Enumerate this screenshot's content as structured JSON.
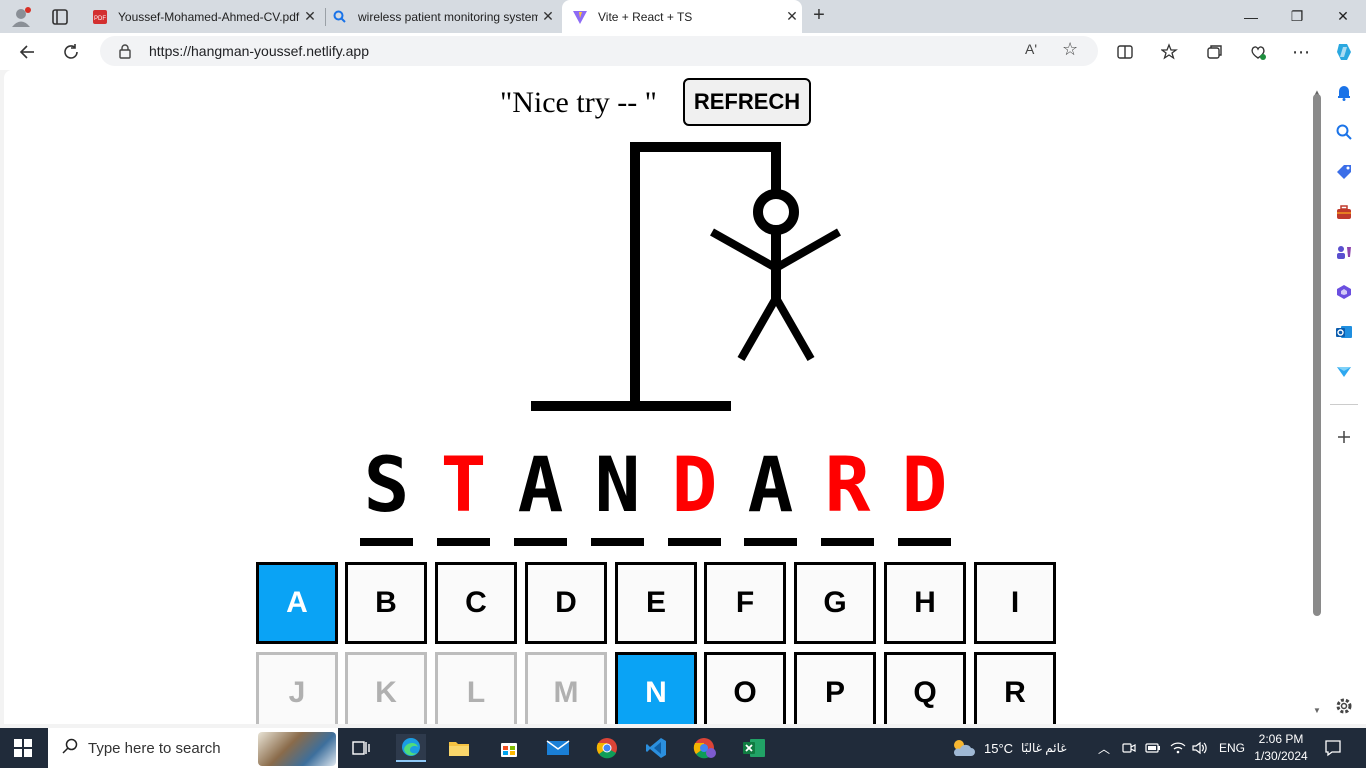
{
  "browser": {
    "tabs": [
      {
        "title": "Youssef-Mohamed-Ahmed-CV.pdf",
        "icon": "pdf-icon"
      },
      {
        "title": "wireless patient monitoring system",
        "icon": "search-icon"
      },
      {
        "title": "Vite + React + TS",
        "icon": "vite-icon"
      }
    ],
    "url": "https://hangman-youssef.netlify.app",
    "read_aloud": "Aʹ"
  },
  "game": {
    "result_text": "\"Nice try -- \"",
    "refresh_label": "REFRECH",
    "word": [
      {
        "ch": "S",
        "color": "#000000"
      },
      {
        "ch": "T",
        "color": "#ff0000"
      },
      {
        "ch": "A",
        "color": "#000000"
      },
      {
        "ch": "N",
        "color": "#000000"
      },
      {
        "ch": "D",
        "color": "#ff0000"
      },
      {
        "ch": "A",
        "color": "#000000"
      },
      {
        "ch": "R",
        "color": "#ff0000"
      },
      {
        "ch": "D",
        "color": "#ff0000"
      }
    ],
    "keys": [
      {
        "label": "A",
        "state": "active"
      },
      {
        "label": "B",
        "state": "normal"
      },
      {
        "label": "C",
        "state": "normal"
      },
      {
        "label": "D",
        "state": "normal"
      },
      {
        "label": "E",
        "state": "normal"
      },
      {
        "label": "F",
        "state": "normal"
      },
      {
        "label": "G",
        "state": "normal"
      },
      {
        "label": "H",
        "state": "normal"
      },
      {
        "label": "I",
        "state": "normal"
      },
      {
        "label": "J",
        "state": "disabled"
      },
      {
        "label": "K",
        "state": "disabled"
      },
      {
        "label": "L",
        "state": "disabled"
      },
      {
        "label": "M",
        "state": "disabled"
      },
      {
        "label": "N",
        "state": "active"
      },
      {
        "label": "O",
        "state": "normal"
      },
      {
        "label": "P",
        "state": "normal"
      },
      {
        "label": "Q",
        "state": "normal"
      },
      {
        "label": "R",
        "state": "normal"
      }
    ],
    "colors": {
      "active": "#0aa3f5",
      "miss": "#ff0000"
    }
  },
  "taskbar": {
    "search_placeholder": "Type here to search",
    "weather_temp": "15°C",
    "weather_text": "غائم غالبًا",
    "lang": "ENG",
    "time": "2:06 PM",
    "date": "1/30/2024"
  }
}
